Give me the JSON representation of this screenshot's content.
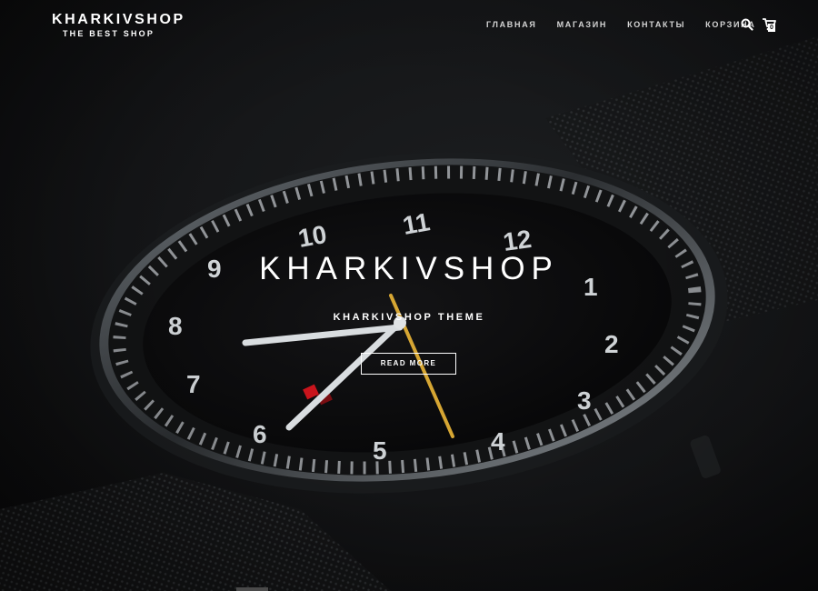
{
  "brand": {
    "title": "KHARKIVSHOP",
    "tagline": "THE BEST SHOP"
  },
  "nav": {
    "items": [
      {
        "label": "ГЛАВНАЯ"
      },
      {
        "label": "МАГАЗИН"
      },
      {
        "label": "КОНТАКТЫ"
      },
      {
        "label": "КОРЗИНА"
      }
    ]
  },
  "header_actions": {
    "search_icon": "search-icon",
    "cart_icon": "cart-icon",
    "cart_count": "0"
  },
  "hero": {
    "title": "KHARKIVSHOP",
    "subtitle": "KHARKIVSHOP THEME",
    "button_label": "READ MORE",
    "background": "dark close-up photo of a wristwatch with mesh strap",
    "dial_numerals": [
      "10",
      "11",
      "12",
      "1",
      "2",
      "3",
      "4",
      "5",
      "6",
      "7",
      "8",
      "9"
    ]
  },
  "colors": {
    "accent_hand": "#d6a633",
    "date_red": "#c9141c",
    "background": "#0e0f10",
    "text": "#ffffff"
  }
}
